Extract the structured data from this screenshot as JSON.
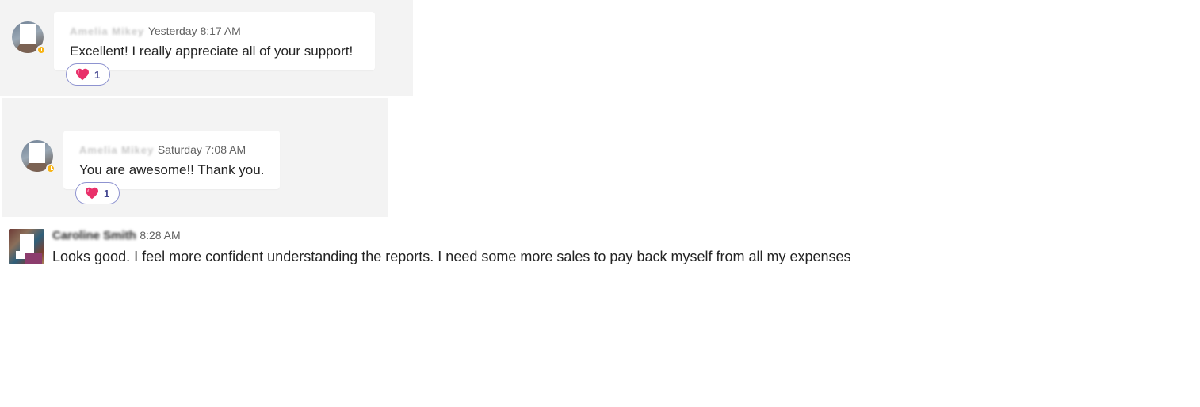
{
  "messages": [
    {
      "sender_name": "Amelia Mikey",
      "timestamp": "Yesterday 8:17 AM",
      "text": "Excellent! I really appreciate all of your support!",
      "status": "away",
      "reaction": {
        "icon": "heart-icon",
        "count": "1"
      }
    },
    {
      "sender_name": "Amelia Mikey",
      "timestamp": "Saturday 7:08 AM",
      "text": "You are awesome!! Thank you.",
      "status": "away",
      "reaction": {
        "icon": "heart-icon",
        "count": "1"
      }
    },
    {
      "sender_name": "Caroline Smith",
      "timestamp": "8:28 AM",
      "text": "Looks good. I feel more confident understanding the reports. I need some more sales to pay back myself from all my expenses"
    }
  ],
  "colors": {
    "panel_bg": "#f3f3f3",
    "reaction_border": "#8e93d0",
    "reaction_count": "#444791",
    "away_status": "#f8b415",
    "heart": "#e0245e"
  }
}
